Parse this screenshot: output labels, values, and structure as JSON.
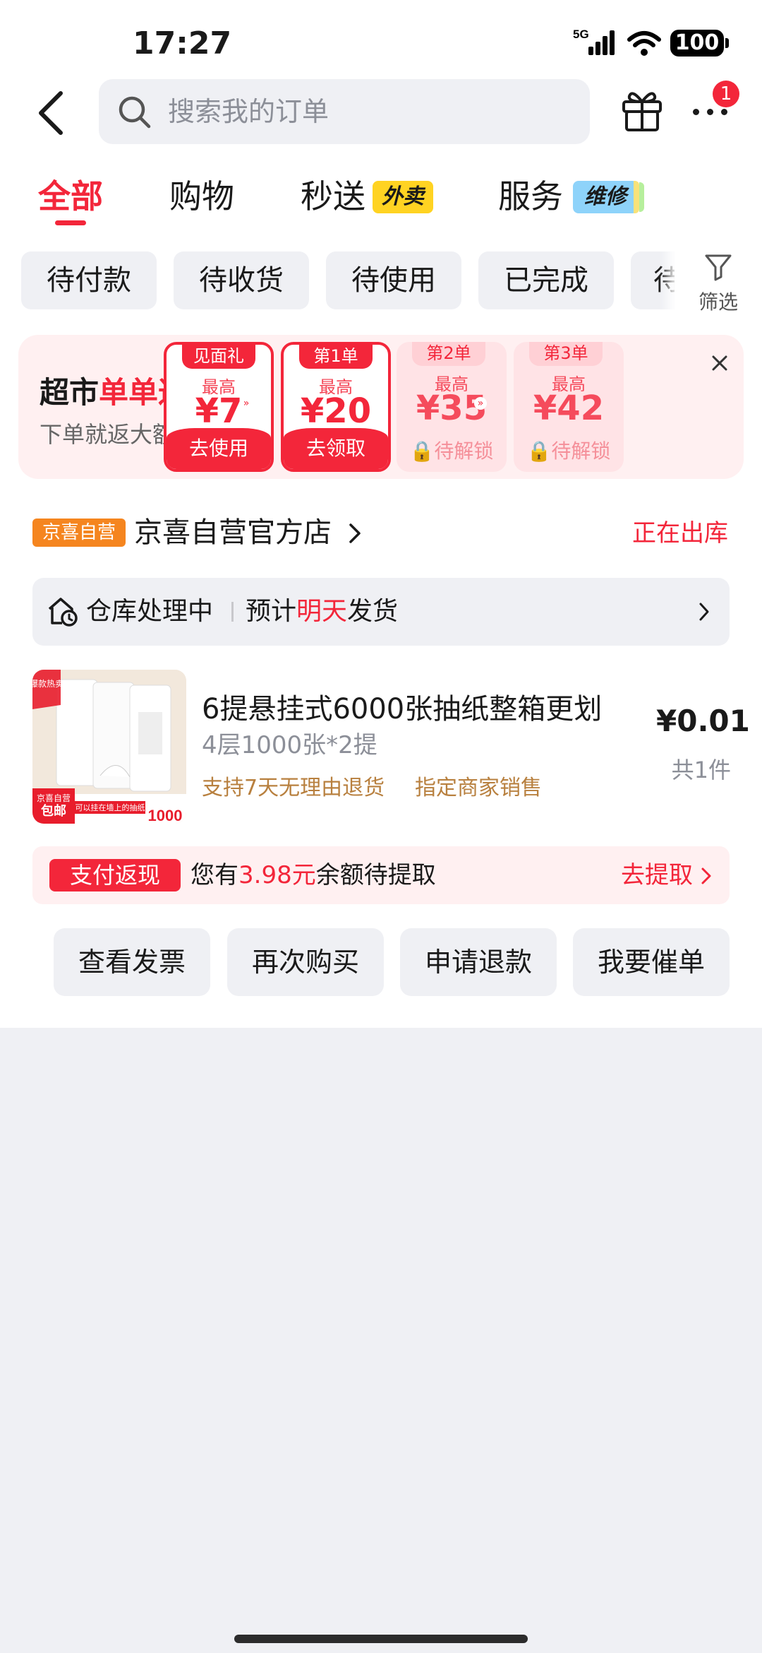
{
  "status_bar": {
    "time": "17:27",
    "network": "5G",
    "battery": "100"
  },
  "search": {
    "placeholder": "搜索我的订单"
  },
  "nav": {
    "notification_count": "1"
  },
  "tabs": [
    {
      "label": "全部",
      "active": true
    },
    {
      "label": "购物"
    },
    {
      "label": "秒送",
      "tag": "外卖"
    },
    {
      "label": "服务",
      "tag": "维修"
    }
  ],
  "status_chips": [
    "待付款",
    "待收货",
    "待使用",
    "已完成",
    "待"
  ],
  "filter": {
    "label": "筛选"
  },
  "promo": {
    "title_prefix": "超市",
    "title_highlight": "单单返",
    "subtitle": "下单就返大额券",
    "coupons": [
      {
        "tag": "见面礼",
        "caption": "最高",
        "amount": "¥7",
        "action": "去使用",
        "state": "active"
      },
      {
        "tag": "第1单",
        "caption": "最高",
        "amount": "¥20",
        "action": "去领取",
        "state": "active"
      },
      {
        "tag": "第2单",
        "caption": "最高",
        "amount": "¥35",
        "action": "待解锁",
        "state": "locked"
      },
      {
        "tag": "第3单",
        "caption": "最高",
        "amount": "¥42",
        "action": "待解锁",
        "state": "locked"
      }
    ]
  },
  "order": {
    "store_tag": "京喜自营",
    "store_name": "京喜自营官方店",
    "status": "正在出库",
    "warehouse": {
      "status": "仓库处理中",
      "estimate_prefix": "预计",
      "estimate_highlight": "明天",
      "estimate_suffix": "发货"
    },
    "product": {
      "title": "6提悬挂式6000张抽纸整箱更划",
      "spec": "4层1000张*2提",
      "tags": [
        "支持7天无理由退货",
        "指定商家销售"
      ],
      "price": "¥0.01",
      "quantity": "共1件",
      "image": {
        "badge_top": "爆款热卖",
        "badge_bottom_line1": "京喜自营",
        "badge_bottom_line2": "包邮",
        "count": "1000",
        "banner": "可以挂在墙上的抽纸"
      }
    },
    "cashback": {
      "tag": "支付返现",
      "text_prefix": "您有",
      "amount": "3.98元",
      "text_suffix": "余额待提取",
      "action": "去提取"
    },
    "actions": [
      "查看发票",
      "再次购买",
      "申请退款",
      "我要催单"
    ]
  },
  "colors": {
    "accent": "#f3263a",
    "store_tag": "#f5851f",
    "tag_gold": "#b8803f"
  }
}
